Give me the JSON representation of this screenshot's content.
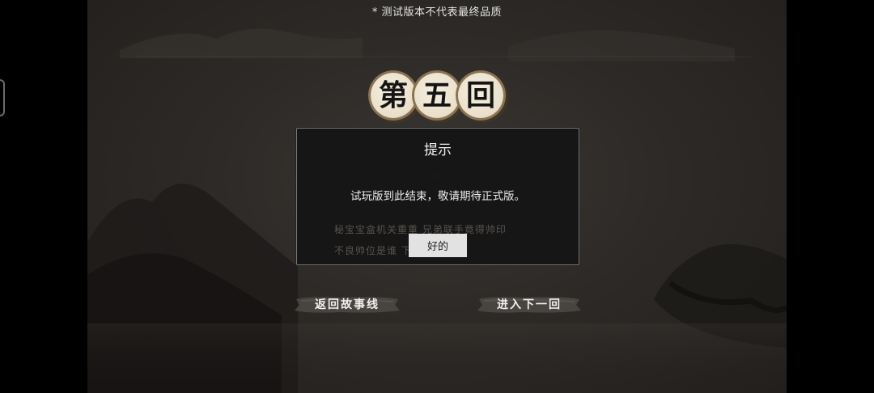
{
  "notice": {
    "text": "* 测试版本不代表最终品质"
  },
  "chapter": {
    "characters": [
      "第",
      "五",
      "回"
    ]
  },
  "dialog": {
    "title": "提示",
    "message": "试玩版到此结束，敬请期待正式版。",
    "background_line_1": "秘宝宝盒机关重重 兄弟联手竟得帅印",
    "background_line_2": "不良帅位是谁                  下回分解",
    "ok_label": "好的"
  },
  "buttons": {
    "back_label": "返回故事线",
    "next_label": "进入下一回"
  },
  "colors": {
    "background": "#2d2a27",
    "seal": "#efe6d3",
    "seal_ring": "#8a7350",
    "dialog": "#141415",
    "ok_button": "#e2e2e2"
  }
}
